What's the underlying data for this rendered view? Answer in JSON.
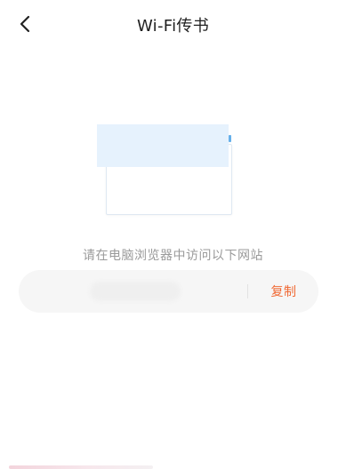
{
  "header": {
    "back_icon": "chevron-left-icon",
    "title": "Wi-Fi传书"
  },
  "illustration": {
    "icon": "computer-browser-icon",
    "colors": {
      "screen": "#e6f2fd",
      "accent": "#66b0ea",
      "frame": "#dfe8f2"
    }
  },
  "instructions": {
    "text": "请在电脑浏览器中访问以下网站"
  },
  "url_bar": {
    "copy_label": "复制",
    "copy_color": "#f06a35"
  }
}
